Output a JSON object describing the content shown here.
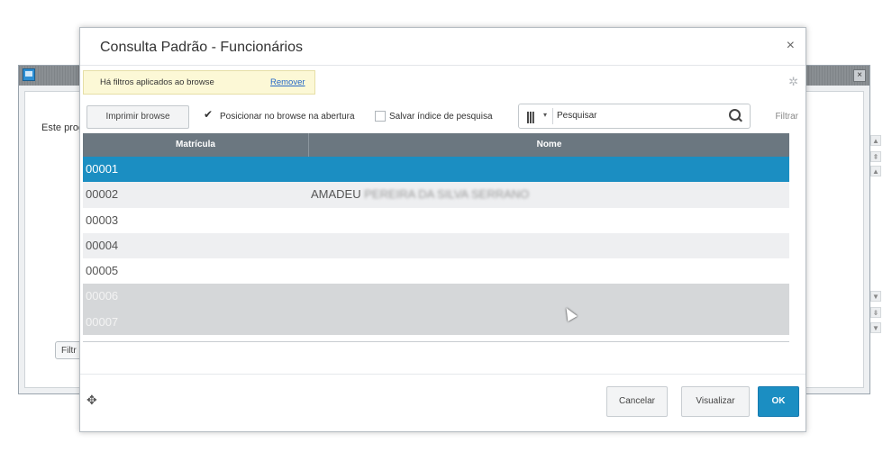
{
  "background_window": {
    "close_label": "×",
    "text": "Este prog",
    "filter_button": "Filtr"
  },
  "dialog": {
    "title": "Consulta Padrão - Funcionários",
    "close": "×",
    "filter_banner": {
      "message": "Há filtros aplicados ao browse",
      "remove_link": "Remover"
    },
    "settings_icon": "gear-icon",
    "toolbar": {
      "print_button": "Imprimir browse",
      "position_checkbox": {
        "label": "Posicionar no browse na abertura",
        "checked": true
      },
      "save_index_checkbox": {
        "label": "Salvar índice de pesquisa",
        "checked": false
      },
      "search": {
        "columns_icon": "|||",
        "caret": "▾",
        "placeholder": "Pesquisar",
        "icon": "search-icon"
      },
      "filter_link": "Filtrar"
    },
    "grid": {
      "columns": [
        "Matrícula",
        "Nome"
      ],
      "rows": [
        {
          "matricula": "00001",
          "nome": "",
          "state": "selected"
        },
        {
          "matricula": "00002",
          "nome": "AMADEU",
          "nome_obscured": "PEREIRA DA SILVA SERRANO",
          "state": "normal"
        },
        {
          "matricula": "00003",
          "nome": "",
          "state": "normal"
        },
        {
          "matricula": "00004",
          "nome": "",
          "state": "normal"
        },
        {
          "matricula": "00005",
          "nome": "",
          "state": "normal"
        },
        {
          "matricula": "00006",
          "nome": "",
          "state": "dimmed"
        },
        {
          "matricula": "00007",
          "nome": "",
          "state": "dimmed"
        }
      ]
    },
    "footer": {
      "move_icon": "✥",
      "cancel": "Cancelar",
      "visualizar": "Visualizar",
      "ok": "OK"
    }
  },
  "colors": {
    "accent": "#1b8ec2",
    "header_bg": "#6b7780",
    "banner_bg": "#fcf8d6"
  }
}
